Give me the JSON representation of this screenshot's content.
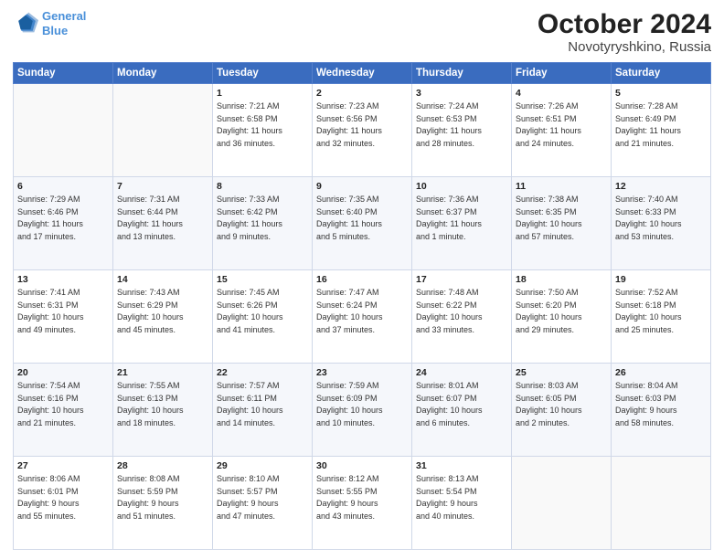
{
  "header": {
    "logo_line1": "General",
    "logo_line2": "Blue",
    "main_title": "October 2024",
    "sub_title": "Novotyryshkino, Russia"
  },
  "weekdays": [
    "Sunday",
    "Monday",
    "Tuesday",
    "Wednesday",
    "Thursday",
    "Friday",
    "Saturday"
  ],
  "weeks": [
    [
      {
        "day": "",
        "detail": ""
      },
      {
        "day": "",
        "detail": ""
      },
      {
        "day": "1",
        "detail": "Sunrise: 7:21 AM\nSunset: 6:58 PM\nDaylight: 11 hours\nand 36 minutes."
      },
      {
        "day": "2",
        "detail": "Sunrise: 7:23 AM\nSunset: 6:56 PM\nDaylight: 11 hours\nand 32 minutes."
      },
      {
        "day": "3",
        "detail": "Sunrise: 7:24 AM\nSunset: 6:53 PM\nDaylight: 11 hours\nand 28 minutes."
      },
      {
        "day": "4",
        "detail": "Sunrise: 7:26 AM\nSunset: 6:51 PM\nDaylight: 11 hours\nand 24 minutes."
      },
      {
        "day": "5",
        "detail": "Sunrise: 7:28 AM\nSunset: 6:49 PM\nDaylight: 11 hours\nand 21 minutes."
      }
    ],
    [
      {
        "day": "6",
        "detail": "Sunrise: 7:29 AM\nSunset: 6:46 PM\nDaylight: 11 hours\nand 17 minutes."
      },
      {
        "day": "7",
        "detail": "Sunrise: 7:31 AM\nSunset: 6:44 PM\nDaylight: 11 hours\nand 13 minutes."
      },
      {
        "day": "8",
        "detail": "Sunrise: 7:33 AM\nSunset: 6:42 PM\nDaylight: 11 hours\nand 9 minutes."
      },
      {
        "day": "9",
        "detail": "Sunrise: 7:35 AM\nSunset: 6:40 PM\nDaylight: 11 hours\nand 5 minutes."
      },
      {
        "day": "10",
        "detail": "Sunrise: 7:36 AM\nSunset: 6:37 PM\nDaylight: 11 hours\nand 1 minute."
      },
      {
        "day": "11",
        "detail": "Sunrise: 7:38 AM\nSunset: 6:35 PM\nDaylight: 10 hours\nand 57 minutes."
      },
      {
        "day": "12",
        "detail": "Sunrise: 7:40 AM\nSunset: 6:33 PM\nDaylight: 10 hours\nand 53 minutes."
      }
    ],
    [
      {
        "day": "13",
        "detail": "Sunrise: 7:41 AM\nSunset: 6:31 PM\nDaylight: 10 hours\nand 49 minutes."
      },
      {
        "day": "14",
        "detail": "Sunrise: 7:43 AM\nSunset: 6:29 PM\nDaylight: 10 hours\nand 45 minutes."
      },
      {
        "day": "15",
        "detail": "Sunrise: 7:45 AM\nSunset: 6:26 PM\nDaylight: 10 hours\nand 41 minutes."
      },
      {
        "day": "16",
        "detail": "Sunrise: 7:47 AM\nSunset: 6:24 PM\nDaylight: 10 hours\nand 37 minutes."
      },
      {
        "day": "17",
        "detail": "Sunrise: 7:48 AM\nSunset: 6:22 PM\nDaylight: 10 hours\nand 33 minutes."
      },
      {
        "day": "18",
        "detail": "Sunrise: 7:50 AM\nSunset: 6:20 PM\nDaylight: 10 hours\nand 29 minutes."
      },
      {
        "day": "19",
        "detail": "Sunrise: 7:52 AM\nSunset: 6:18 PM\nDaylight: 10 hours\nand 25 minutes."
      }
    ],
    [
      {
        "day": "20",
        "detail": "Sunrise: 7:54 AM\nSunset: 6:16 PM\nDaylight: 10 hours\nand 21 minutes."
      },
      {
        "day": "21",
        "detail": "Sunrise: 7:55 AM\nSunset: 6:13 PM\nDaylight: 10 hours\nand 18 minutes."
      },
      {
        "day": "22",
        "detail": "Sunrise: 7:57 AM\nSunset: 6:11 PM\nDaylight: 10 hours\nand 14 minutes."
      },
      {
        "day": "23",
        "detail": "Sunrise: 7:59 AM\nSunset: 6:09 PM\nDaylight: 10 hours\nand 10 minutes."
      },
      {
        "day": "24",
        "detail": "Sunrise: 8:01 AM\nSunset: 6:07 PM\nDaylight: 10 hours\nand 6 minutes."
      },
      {
        "day": "25",
        "detail": "Sunrise: 8:03 AM\nSunset: 6:05 PM\nDaylight: 10 hours\nand 2 minutes."
      },
      {
        "day": "26",
        "detail": "Sunrise: 8:04 AM\nSunset: 6:03 PM\nDaylight: 9 hours\nand 58 minutes."
      }
    ],
    [
      {
        "day": "27",
        "detail": "Sunrise: 8:06 AM\nSunset: 6:01 PM\nDaylight: 9 hours\nand 55 minutes."
      },
      {
        "day": "28",
        "detail": "Sunrise: 8:08 AM\nSunset: 5:59 PM\nDaylight: 9 hours\nand 51 minutes."
      },
      {
        "day": "29",
        "detail": "Sunrise: 8:10 AM\nSunset: 5:57 PM\nDaylight: 9 hours\nand 47 minutes."
      },
      {
        "day": "30",
        "detail": "Sunrise: 8:12 AM\nSunset: 5:55 PM\nDaylight: 9 hours\nand 43 minutes."
      },
      {
        "day": "31",
        "detail": "Sunrise: 8:13 AM\nSunset: 5:54 PM\nDaylight: 9 hours\nand 40 minutes."
      },
      {
        "day": "",
        "detail": ""
      },
      {
        "day": "",
        "detail": ""
      }
    ]
  ]
}
